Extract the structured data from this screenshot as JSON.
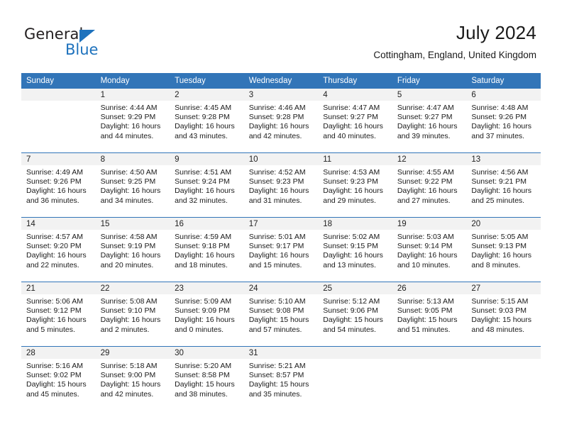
{
  "brand": {
    "name_part1": "General",
    "name_part2": "Blue",
    "triangle_icon": "triangle-icon",
    "colors": {
      "blue": "#1e72bd",
      "dark": "#231f20"
    }
  },
  "header": {
    "title": "July 2024",
    "subtitle": "Cottingham, England, United Kingdom"
  },
  "theme": {
    "header_bar": "#3275b8",
    "daynum_strip": "#f2f2f2",
    "text": "#1a1a1a"
  },
  "calendar": {
    "weekday_headers": [
      "Sunday",
      "Monday",
      "Tuesday",
      "Wednesday",
      "Thursday",
      "Friday",
      "Saturday"
    ],
    "weeks": [
      [
        {
          "day": "",
          "lines": []
        },
        {
          "day": "1",
          "lines": [
            "Sunrise: 4:44 AM",
            "Sunset: 9:29 PM",
            "Daylight: 16 hours",
            "and 44 minutes."
          ]
        },
        {
          "day": "2",
          "lines": [
            "Sunrise: 4:45 AM",
            "Sunset: 9:28 PM",
            "Daylight: 16 hours",
            "and 43 minutes."
          ]
        },
        {
          "day": "3",
          "lines": [
            "Sunrise: 4:46 AM",
            "Sunset: 9:28 PM",
            "Daylight: 16 hours",
            "and 42 minutes."
          ]
        },
        {
          "day": "4",
          "lines": [
            "Sunrise: 4:47 AM",
            "Sunset: 9:27 PM",
            "Daylight: 16 hours",
            "and 40 minutes."
          ]
        },
        {
          "day": "5",
          "lines": [
            "Sunrise: 4:47 AM",
            "Sunset: 9:27 PM",
            "Daylight: 16 hours",
            "and 39 minutes."
          ]
        },
        {
          "day": "6",
          "lines": [
            "Sunrise: 4:48 AM",
            "Sunset: 9:26 PM",
            "Daylight: 16 hours",
            "and 37 minutes."
          ]
        }
      ],
      [
        {
          "day": "7",
          "lines": [
            "Sunrise: 4:49 AM",
            "Sunset: 9:26 PM",
            "Daylight: 16 hours",
            "and 36 minutes."
          ]
        },
        {
          "day": "8",
          "lines": [
            "Sunrise: 4:50 AM",
            "Sunset: 9:25 PM",
            "Daylight: 16 hours",
            "and 34 minutes."
          ]
        },
        {
          "day": "9",
          "lines": [
            "Sunrise: 4:51 AM",
            "Sunset: 9:24 PM",
            "Daylight: 16 hours",
            "and 32 minutes."
          ]
        },
        {
          "day": "10",
          "lines": [
            "Sunrise: 4:52 AM",
            "Sunset: 9:23 PM",
            "Daylight: 16 hours",
            "and 31 minutes."
          ]
        },
        {
          "day": "11",
          "lines": [
            "Sunrise: 4:53 AM",
            "Sunset: 9:23 PM",
            "Daylight: 16 hours",
            "and 29 minutes."
          ]
        },
        {
          "day": "12",
          "lines": [
            "Sunrise: 4:55 AM",
            "Sunset: 9:22 PM",
            "Daylight: 16 hours",
            "and 27 minutes."
          ]
        },
        {
          "day": "13",
          "lines": [
            "Sunrise: 4:56 AM",
            "Sunset: 9:21 PM",
            "Daylight: 16 hours",
            "and 25 minutes."
          ]
        }
      ],
      [
        {
          "day": "14",
          "lines": [
            "Sunrise: 4:57 AM",
            "Sunset: 9:20 PM",
            "Daylight: 16 hours",
            "and 22 minutes."
          ]
        },
        {
          "day": "15",
          "lines": [
            "Sunrise: 4:58 AM",
            "Sunset: 9:19 PM",
            "Daylight: 16 hours",
            "and 20 minutes."
          ]
        },
        {
          "day": "16",
          "lines": [
            "Sunrise: 4:59 AM",
            "Sunset: 9:18 PM",
            "Daylight: 16 hours",
            "and 18 minutes."
          ]
        },
        {
          "day": "17",
          "lines": [
            "Sunrise: 5:01 AM",
            "Sunset: 9:17 PM",
            "Daylight: 16 hours",
            "and 15 minutes."
          ]
        },
        {
          "day": "18",
          "lines": [
            "Sunrise: 5:02 AM",
            "Sunset: 9:15 PM",
            "Daylight: 16 hours",
            "and 13 minutes."
          ]
        },
        {
          "day": "19",
          "lines": [
            "Sunrise: 5:03 AM",
            "Sunset: 9:14 PM",
            "Daylight: 16 hours",
            "and 10 minutes."
          ]
        },
        {
          "day": "20",
          "lines": [
            "Sunrise: 5:05 AM",
            "Sunset: 9:13 PM",
            "Daylight: 16 hours",
            "and 8 minutes."
          ]
        }
      ],
      [
        {
          "day": "21",
          "lines": [
            "Sunrise: 5:06 AM",
            "Sunset: 9:12 PM",
            "Daylight: 16 hours",
            "and 5 minutes."
          ]
        },
        {
          "day": "22",
          "lines": [
            "Sunrise: 5:08 AM",
            "Sunset: 9:10 PM",
            "Daylight: 16 hours",
            "and 2 minutes."
          ]
        },
        {
          "day": "23",
          "lines": [
            "Sunrise: 5:09 AM",
            "Sunset: 9:09 PM",
            "Daylight: 16 hours",
            "and 0 minutes."
          ]
        },
        {
          "day": "24",
          "lines": [
            "Sunrise: 5:10 AM",
            "Sunset: 9:08 PM",
            "Daylight: 15 hours",
            "and 57 minutes."
          ]
        },
        {
          "day": "25",
          "lines": [
            "Sunrise: 5:12 AM",
            "Sunset: 9:06 PM",
            "Daylight: 15 hours",
            "and 54 minutes."
          ]
        },
        {
          "day": "26",
          "lines": [
            "Sunrise: 5:13 AM",
            "Sunset: 9:05 PM",
            "Daylight: 15 hours",
            "and 51 minutes."
          ]
        },
        {
          "day": "27",
          "lines": [
            "Sunrise: 5:15 AM",
            "Sunset: 9:03 PM",
            "Daylight: 15 hours",
            "and 48 minutes."
          ]
        }
      ],
      [
        {
          "day": "28",
          "lines": [
            "Sunrise: 5:16 AM",
            "Sunset: 9:02 PM",
            "Daylight: 15 hours",
            "and 45 minutes."
          ]
        },
        {
          "day": "29",
          "lines": [
            "Sunrise: 5:18 AM",
            "Sunset: 9:00 PM",
            "Daylight: 15 hours",
            "and 42 minutes."
          ]
        },
        {
          "day": "30",
          "lines": [
            "Sunrise: 5:20 AM",
            "Sunset: 8:58 PM",
            "Daylight: 15 hours",
            "and 38 minutes."
          ]
        },
        {
          "day": "31",
          "lines": [
            "Sunrise: 5:21 AM",
            "Sunset: 8:57 PM",
            "Daylight: 15 hours",
            "and 35 minutes."
          ]
        },
        {
          "day": "",
          "lines": []
        },
        {
          "day": "",
          "lines": []
        },
        {
          "day": "",
          "lines": []
        }
      ]
    ]
  }
}
